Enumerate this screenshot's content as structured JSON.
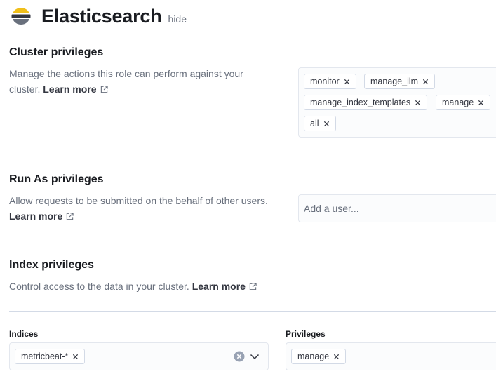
{
  "header": {
    "title": "Elasticsearch",
    "hide_label": "hide",
    "logo_icon": "elasticsearch-logo",
    "logo_colors": [
      "#f0bf1a",
      "#343741",
      "#69707d"
    ]
  },
  "cluster": {
    "title": "Cluster privileges",
    "description": "Manage the actions this role can perform against your cluster.",
    "learn_more": "Learn more",
    "privileges": [
      "monitor",
      "manage_ilm",
      "manage_index_templates",
      "manage",
      "all"
    ]
  },
  "run_as": {
    "title": "Run As privileges",
    "description": "Allow requests to be submitted on the behalf of other users.",
    "learn_more": "Learn more",
    "placeholder": "Add a user..."
  },
  "index": {
    "title": "Index privileges",
    "description": "Control access to the data in your cluster.",
    "learn_more": "Learn more",
    "indices_label": "Indices",
    "indices": [
      "metricbeat-*"
    ],
    "privileges_label": "Privileges",
    "privileges": [
      "manage"
    ]
  },
  "icons": {
    "external_link": "popout-icon",
    "remove": "cross-icon",
    "clear": "clear-circle-icon",
    "expand": "chevron-down-icon"
  }
}
